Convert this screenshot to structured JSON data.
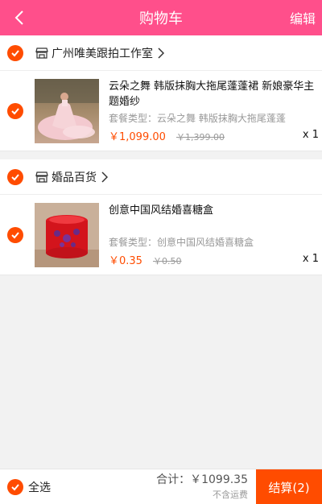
{
  "header": {
    "title": "购物车",
    "edit_label": "编辑"
  },
  "shops": [
    {
      "name": "广州唯美跟拍工作室",
      "items": [
        {
          "name": "云朵之舞 韩版抹胸大拖尾蓬蓬裙 新娘豪华主题婚纱",
          "spec": "套餐类型：云朵之舞 韩版抹胸大拖尾蓬蓬",
          "price": "￥1,099.00",
          "orig_price": "￥1,399.00",
          "qty": "x 1",
          "image": "wedding-dress-photo"
        }
      ]
    },
    {
      "name": "婚品百货",
      "items": [
        {
          "name": "创意中国风结婚喜糖盒",
          "spec": "套餐类型：创意中国风结婚喜糖盒",
          "price": "￥0.35",
          "orig_price": "￥0.50",
          "qty": "x 1",
          "image": "red-candy-box-photo"
        }
      ]
    }
  ],
  "footer": {
    "select_all_label": "全选",
    "total_label": "合计：",
    "total_amount": "￥1099.35",
    "shipping_note": "不含运费",
    "checkout_label": "结算(2)"
  },
  "colors": {
    "header": "#ff4f8b",
    "accent": "#ff4c00"
  }
}
